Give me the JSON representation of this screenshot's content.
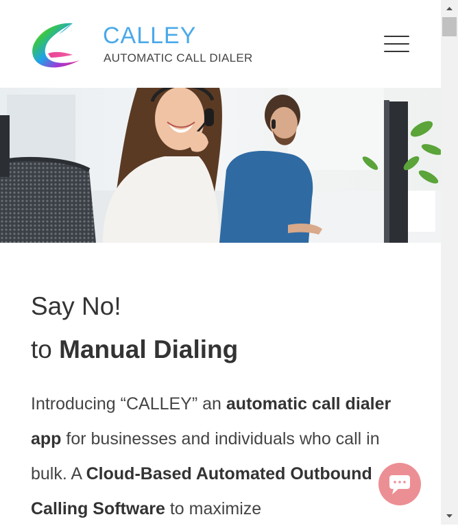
{
  "header": {
    "brand_name": "CALLEY",
    "brand_tagline": "AUTOMATIC CALL DIALER",
    "menu_icon": "hamburger-menu-icon"
  },
  "hero": {
    "image": "call-center-agents-with-headsets"
  },
  "main": {
    "headline_line1": "Say No!",
    "headline_line2_prefix": "to ",
    "headline_line2_bold": "Manual Dialing",
    "intro": [
      {
        "text": "Introducing “CALLEY” an ",
        "bold": false
      },
      {
        "text": "automatic call dialer app",
        "bold": true
      },
      {
        "text": " for businesses and individuals who call in bulk. A ",
        "bold": false
      },
      {
        "text": "Cloud-Based Automated Outbound Calling Software",
        "bold": true
      },
      {
        "text": " to maximize",
        "bold": false
      }
    ]
  },
  "chat": {
    "icon": "chat-bubble-icon",
    "color": "#ec8f94"
  },
  "colors": {
    "brand_blue": "#4aa9e9",
    "text_dark": "#333333"
  }
}
